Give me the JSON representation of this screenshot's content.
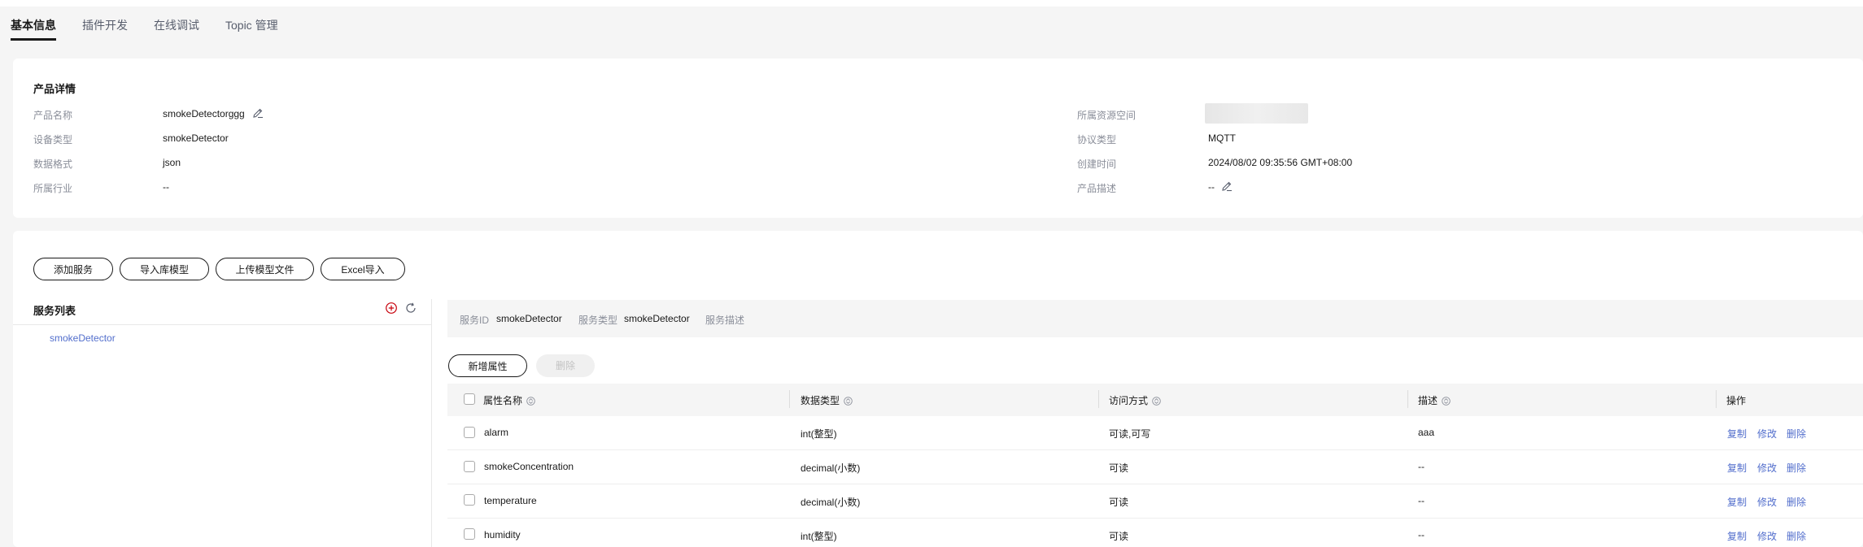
{
  "tabs": [
    {
      "label": "基本信息"
    },
    {
      "label": "插件开发"
    },
    {
      "label": "在线调试"
    },
    {
      "label": "Topic 管理"
    }
  ],
  "product": {
    "title": "产品详情",
    "left": [
      {
        "label": "产品名称",
        "value": "smokeDetectorggg"
      },
      {
        "label": "设备类型",
        "value": "smokeDetector"
      },
      {
        "label": "数据格式",
        "value": "json"
      },
      {
        "label": "所属行业",
        "value": "--"
      }
    ],
    "right": [
      {
        "label": "所属资源空间",
        "value": ""
      },
      {
        "label": "协议类型",
        "value": "MQTT"
      },
      {
        "label": "创建时间",
        "value": "2024/08/02 09:35:56 GMT+08:00"
      },
      {
        "label": "产品描述",
        "value": "--"
      }
    ]
  },
  "actions": {
    "add_service": "添加服务",
    "import_library": "导入库模型",
    "upload_model": "上传模型文件",
    "excel_import": "Excel导入"
  },
  "services": {
    "title": "服务列表",
    "items": [
      "smokeDetector"
    ]
  },
  "service_info": {
    "id_label": "服务ID",
    "id_value": "smokeDetector",
    "type_label": "服务类型",
    "type_value": "smokeDetector",
    "desc_label": "服务描述"
  },
  "property_actions": {
    "add": "新增属性",
    "delete": "删除"
  },
  "table": {
    "headers": [
      "属性名称",
      "数据类型",
      "访问方式",
      "描述",
      "操作"
    ],
    "rows": [
      {
        "name": "alarm",
        "type": "int(整型)",
        "access": "可读,可写",
        "desc": "aaa"
      },
      {
        "name": "smokeConcentration",
        "type": "decimal(小数)",
        "access": "可读",
        "desc": "--"
      },
      {
        "name": "temperature",
        "type": "decimal(小数)",
        "access": "可读",
        "desc": "--"
      },
      {
        "name": "humidity",
        "type": "int(整型)",
        "access": "可读",
        "desc": "--"
      }
    ],
    "ops": {
      "copy": "复制",
      "edit": "修改",
      "delete": "删除"
    }
  },
  "colors": {
    "accent": "#526ecc",
    "add_icon": "#c7000b",
    "text": "#191919",
    "muted": "#8a8e99",
    "background": "#f5f5f5"
  }
}
